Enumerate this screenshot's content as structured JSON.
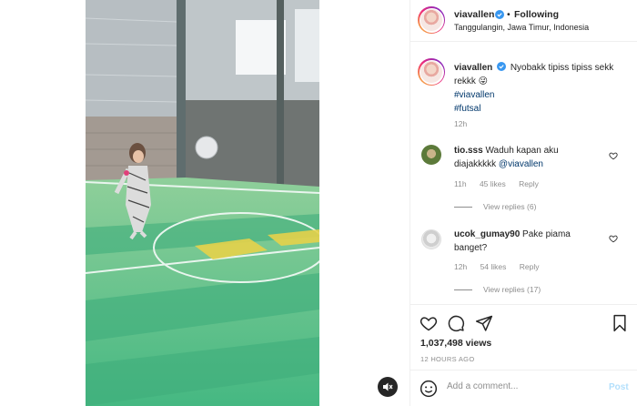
{
  "header": {
    "username": "viavallen",
    "separator": "•",
    "follow_status": "Following",
    "location": "Tanggulangin, Jawa Timur, Indonesia"
  },
  "caption": {
    "username": "viavallen",
    "text": "Nyobakk tipiss tipiss sekk rekkk 😜",
    "hashtags": [
      "#viavallen",
      "#futsal"
    ],
    "time": "12h"
  },
  "comments": [
    {
      "username": "tio.sss",
      "text_line1": "Waduh kapan aku",
      "text_line2": "diajakkkkk",
      "mention": "@viavallen",
      "time": "11h",
      "likes": "45 likes",
      "reply": "Reply",
      "view_replies": "View replies (6)"
    },
    {
      "username": "ucok_gumay90",
      "text_line1": "Pake piama",
      "text_line2": "banget?",
      "time": "12h",
      "likes": "54 likes",
      "reply": "Reply",
      "view_replies": "View replies (17)"
    }
  ],
  "stats": {
    "views": "1,037,498 views",
    "time_ago": "12 HOURS AGO"
  },
  "composer": {
    "placeholder": "Add a comment...",
    "post_label": "Post"
  },
  "icons": {
    "like": "heart-icon",
    "comment": "comment-icon",
    "share": "paper-plane-icon",
    "save": "bookmark-icon",
    "mute": "speaker-muted-icon",
    "emoji": "smiley-icon",
    "verified": "verified-badge-icon"
  },
  "colors": {
    "verified": "#3897f0",
    "link": "#00376b",
    "muted": "#8e8e8e",
    "post_disabled": "#b2dffc"
  }
}
